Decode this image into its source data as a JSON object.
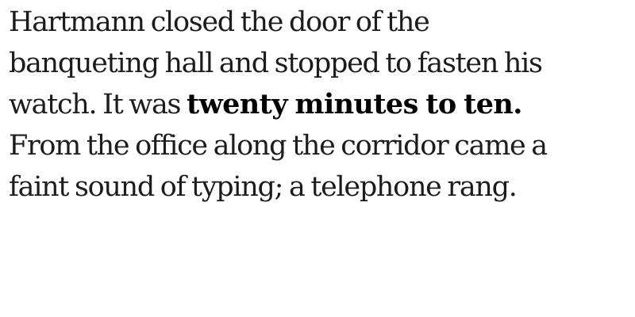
{
  "text": {
    "line1": "Hartmann closed the door of the",
    "line2": "banqueting hall and stopped to fasten his",
    "line3_pre": "watch. It was ",
    "line3_bold": "twenty minutes to ten.",
    "line4": "From the office along the corridor came a",
    "line5": "faint sound of typing; a telephone rang."
  }
}
